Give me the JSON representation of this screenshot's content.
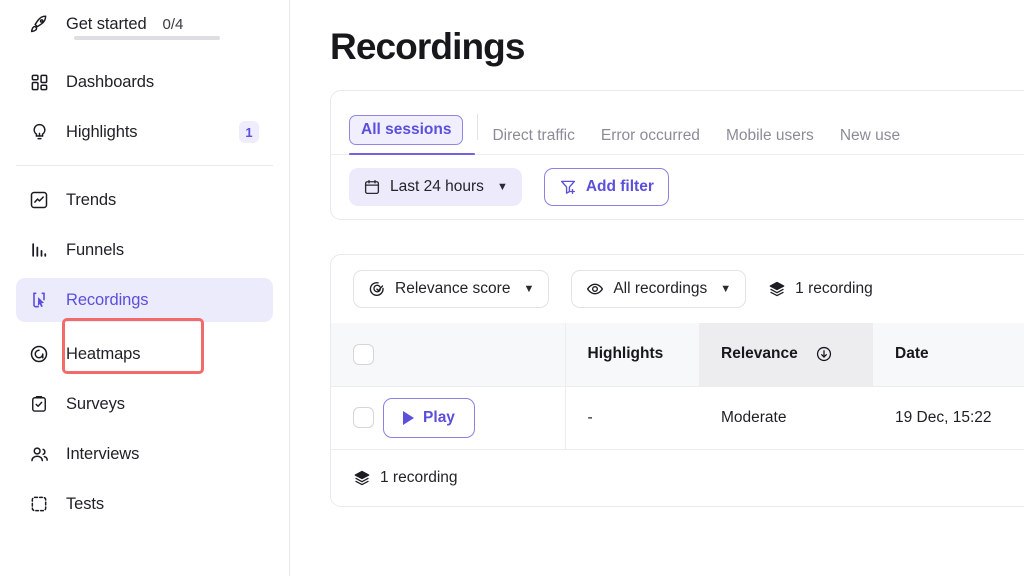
{
  "sidebar": {
    "top_items": [
      {
        "label": "Get started",
        "icon": "rocket-icon",
        "count": "0/4",
        "progress": 0
      },
      {
        "label": "Dashboards",
        "icon": "dashboard-grid-icon"
      },
      {
        "label": "Highlights",
        "icon": "lightbulb-icon",
        "badge": "1"
      }
    ],
    "items": [
      {
        "label": "Trends",
        "icon": "trends-chart-icon",
        "active": false
      },
      {
        "label": "Funnels",
        "icon": "funnels-bars-icon",
        "active": false
      },
      {
        "label": "Recordings",
        "icon": "recordings-cursor-icon",
        "active": true
      },
      {
        "label": "Heatmaps",
        "icon": "heatmap-icon",
        "active": false
      },
      {
        "label": "Surveys",
        "icon": "clipboard-check-icon",
        "active": false
      },
      {
        "label": "Interviews",
        "icon": "people-icon",
        "active": false
      },
      {
        "label": "Tests",
        "icon": "tests-icon",
        "active": false
      }
    ]
  },
  "main": {
    "page_title": "Recordings",
    "tabs": [
      {
        "label": "All sessions",
        "selected": true
      },
      {
        "label": "Direct traffic",
        "selected": false
      },
      {
        "label": "Error occurred",
        "selected": false
      },
      {
        "label": "Mobile users",
        "selected": false
      },
      {
        "label": "New use",
        "selected": false
      }
    ],
    "filters": {
      "date_range_label": "Last 24 hours",
      "date_range_icon": "calendar-icon",
      "add_filter_label": "Add filter",
      "add_filter_icon": "filter-plus-icon"
    },
    "toolbar": {
      "sort_label": "Relevance score",
      "sort_icon": "relevance-target-icon",
      "view_label": "All recordings",
      "view_icon": "eye-icon",
      "count_label": "1 recording",
      "count_icon": "layers-icon"
    },
    "table": {
      "columns": [
        "",
        "",
        "Highlights",
        "Relevance",
        "Date"
      ],
      "sorted_column": "Relevance",
      "sort_direction_icon": "sort-desc-circle-icon",
      "rows": [
        {
          "play_label": "Play",
          "highlights": "-",
          "relevance": "Moderate",
          "date": "19 Dec, 15:22"
        }
      ],
      "footer_label": "1 recording",
      "footer_icon": "layers-icon"
    }
  },
  "annotation": {
    "target": "Recordings",
    "color": "#f26a6a"
  },
  "colors": {
    "accent_purple": "#5b4fdb",
    "active_bg": "#ecebfb",
    "annotation_red": "#f26a6a",
    "header_gray": "#f7f8f9",
    "sorted_col_gray": "#ededf0"
  }
}
